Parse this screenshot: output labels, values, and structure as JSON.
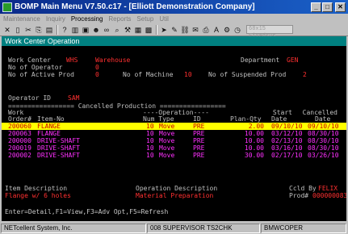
{
  "window": {
    "title": "BOMP Main Menu V7.50.c17 - [Elliott Demonstration Company]"
  },
  "menu": [
    "Maintenance",
    "Inquiry",
    "Processing",
    "Reports",
    "Setup",
    "Util"
  ],
  "toolbar": {
    "field_placeholder": "68x15 Fixedsys"
  },
  "panel": {
    "title": "Work Center Operation"
  },
  "header": {
    "work_center_label": "Work Center",
    "work_center_value": "WHS",
    "work_center_desc": "Warehouse",
    "department_label": "Department",
    "department_value": "GEN",
    "no_of_operator_label": "No of Operator",
    "no_of_operator_value": "0",
    "no_of_active_prod_label": "No of Active Prod",
    "no_of_active_prod_value": "0",
    "no_of_machine_label": "No of Machine",
    "no_of_machine_value": "10",
    "no_of_suspended_prod_label": "No of Suspended Prod",
    "no_of_suspended_prod_value": "2",
    "operator_id_label": "Operator ID",
    "operator_id_value": "SAM"
  },
  "table": {
    "banner": "================= Cancelled Production =================",
    "hdr1": {
      "work": "Work",
      "operation": "----Operation----",
      "start": "Start",
      "cancelled": "Cancelled"
    },
    "hdr2": {
      "order": "Order#",
      "item_no": "Item-No",
      "num_type": "Num Type",
      "id": "ID",
      "plan_qty": "Plan-Qty",
      "start_date": "Date",
      "cancelled_date": "Date"
    },
    "rows": [
      {
        "order": "200060",
        "item": "FLANGE",
        "num": "10",
        "type": "Move",
        "id": "PRE",
        "qty": "2.00",
        "start": "09/10/10",
        "cancelled": "09/10/10"
      },
      {
        "order": "200063",
        "item": "FLANGE",
        "num": "10",
        "type": "Move",
        "id": "PRE",
        "qty": "10.00",
        "start": "03/12/10",
        "cancelled": "08/30/10"
      },
      {
        "order": "200000",
        "item": "DRIVE-SHAFT",
        "num": "10",
        "type": "Move",
        "id": "PRE",
        "qty": "10.00",
        "start": "02/13/10",
        "cancelled": "08/30/10"
      },
      {
        "order": "200019",
        "item": "DRIVE-SHAFT",
        "num": "10",
        "type": "Move",
        "id": "PRE",
        "qty": "10.00",
        "start": "03/16/10",
        "cancelled": "08/30/10"
      },
      {
        "order": "200002",
        "item": "DRIVE-SHAFT",
        "num": "10",
        "type": "Move",
        "id": "PRE",
        "qty": "30.00",
        "start": "02/17/10",
        "cancelled": "03/26/10"
      }
    ]
  },
  "footer": {
    "item_description_label": "Item Description",
    "item_description_value": "Flange w/ 6 holes",
    "operation_description_label": "Operation Description",
    "operation_description_value": "Material Preparation",
    "ccld_by_label": "Ccld By",
    "ccld_by_value": "FELIX",
    "prod_label": "Prod#",
    "prod_value": "000000083",
    "hint": "Enter=Detail,F1=View,F3=Adv Opt,F5=Refresh"
  },
  "status": {
    "company": "NETcellent System, Inc.",
    "user": "008 SUPERVISOR TS2CHK",
    "program": "BMWCOPER"
  }
}
